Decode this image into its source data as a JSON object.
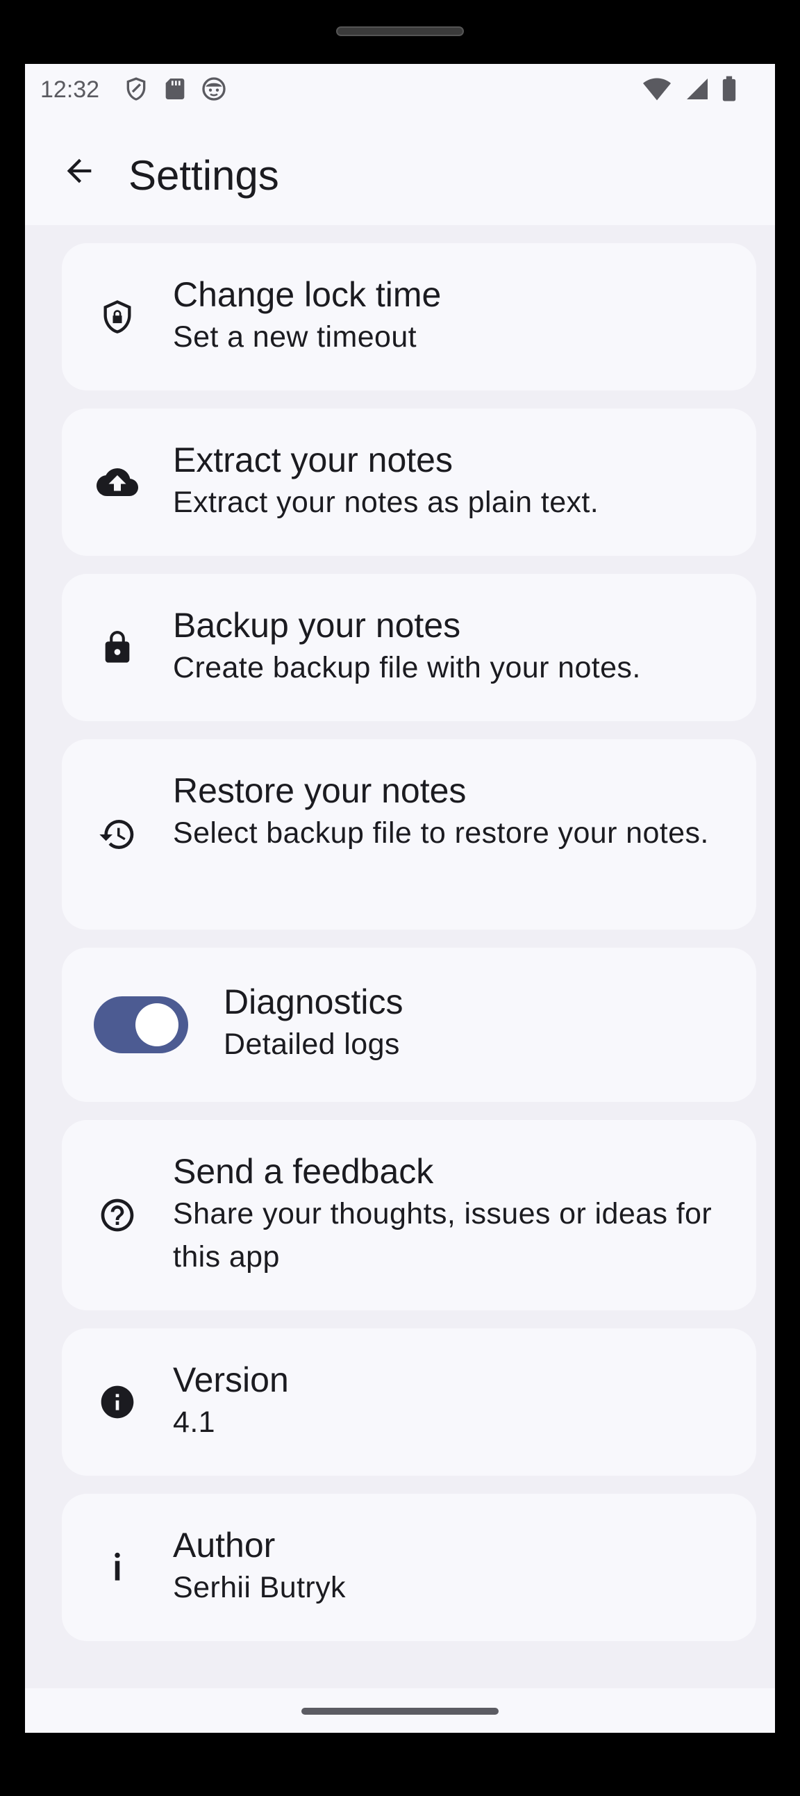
{
  "status_bar": {
    "time": "12:32",
    "left_icons": [
      "shield-icon",
      "sd-card-icon",
      "face-icon"
    ],
    "right_icons": [
      "wifi-icon",
      "cell-signal-icon",
      "battery-icon"
    ]
  },
  "app_bar": {
    "title": "Settings",
    "back_icon": "arrow-back-icon"
  },
  "settings": [
    {
      "id": "change-lock-time",
      "icon": "shield-lock-icon",
      "title": "Change lock time",
      "subtitle": "Set a new timeout"
    },
    {
      "id": "extract-notes",
      "icon": "cloud-upload-icon",
      "title": "Extract your notes",
      "subtitle": "Extract your notes as plain text."
    },
    {
      "id": "backup-notes",
      "icon": "lock-icon",
      "title": "Backup your notes",
      "subtitle": "Create backup file with your notes."
    },
    {
      "id": "restore-notes",
      "icon": "history-icon",
      "title": "Restore your notes",
      "subtitle": "Select backup file to restore your notes."
    },
    {
      "id": "diagnostics",
      "icon": "toggle",
      "title": "Diagnostics",
      "subtitle": "Detailed logs",
      "toggle_on": true
    },
    {
      "id": "send-feedback",
      "icon": "help-circle-icon",
      "title": "Send a feedback",
      "subtitle": "Share your thoughts, issues or ideas for this app"
    },
    {
      "id": "version",
      "icon": "info-icon",
      "title": "Version",
      "subtitle": "4.1"
    },
    {
      "id": "author",
      "icon": "info-letter-icon",
      "title": "Author",
      "subtitle": "Serhii Butryk"
    }
  ],
  "colors": {
    "background": "#f0eff5",
    "surface": "#f8f8fc",
    "text": "#1b1b20",
    "toggle_track": "#4c5b92",
    "toggle_thumb": "#ffffff"
  }
}
